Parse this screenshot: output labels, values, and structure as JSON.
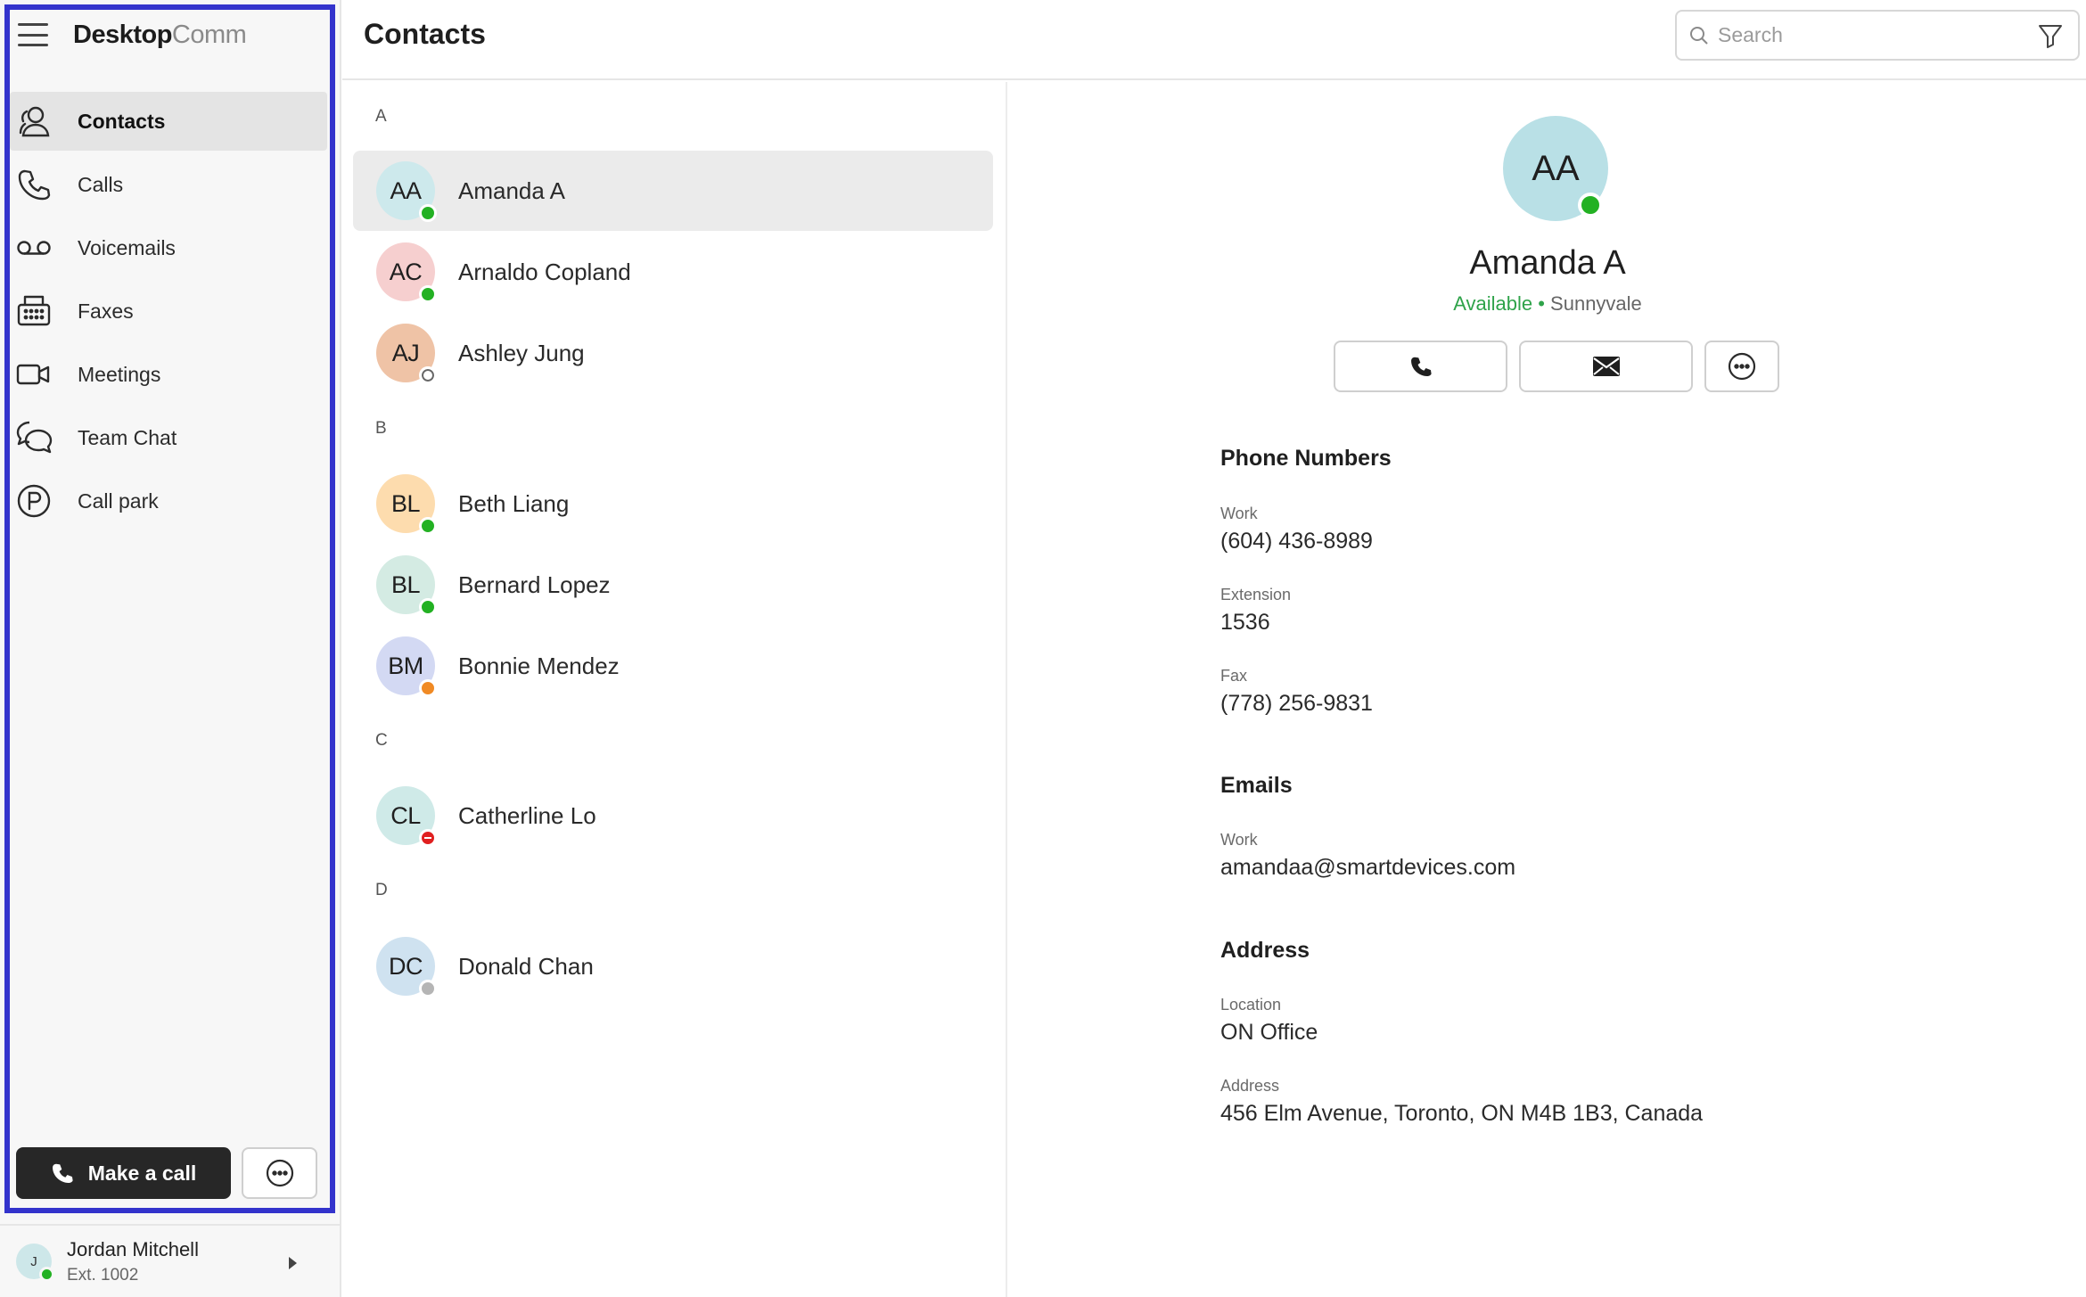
{
  "app": {
    "brand_bold": "Desktop",
    "brand_light": "Comm"
  },
  "nav": [
    {
      "label": "Contacts",
      "icon": "contacts-icon",
      "active": true
    },
    {
      "label": "Calls",
      "icon": "phone-icon",
      "active": false
    },
    {
      "label": "Voicemails",
      "icon": "voicemail-icon",
      "active": false
    },
    {
      "label": "Faxes",
      "icon": "fax-icon",
      "active": false
    },
    {
      "label": "Meetings",
      "icon": "video-icon",
      "active": false
    },
    {
      "label": "Team Chat",
      "icon": "chat-icon",
      "active": false
    },
    {
      "label": "Call park",
      "icon": "park-icon",
      "active": false
    }
  ],
  "make_call_label": "Make a call",
  "user": {
    "initial": "J",
    "name": "Jordan Mitchell",
    "ext": "Ext. 1002",
    "status": "available"
  },
  "header": {
    "title": "Contacts",
    "search_placeholder": "Search"
  },
  "sections": [
    {
      "letter": "A",
      "contacts": [
        {
          "initials": "AA",
          "name": "Amanda A",
          "status": "available",
          "color": "#cde9ec",
          "selected": true
        },
        {
          "initials": "AC",
          "name": "Arnaldo Copland",
          "status": "available",
          "color": "#f6cfcf"
        },
        {
          "initials": "AJ",
          "name": "Ashley Jung",
          "status": "offline",
          "color": "#efc3a6"
        }
      ]
    },
    {
      "letter": "B",
      "contacts": [
        {
          "initials": "BL",
          "name": "Beth Liang",
          "status": "available",
          "color": "#fddcae"
        },
        {
          "initials": "BL",
          "name": "Bernard Lopez",
          "status": "available",
          "color": "#d4ebe3"
        },
        {
          "initials": "BM",
          "name": "Bonnie Mendez",
          "status": "away",
          "color": "#d3d9f3"
        }
      ]
    },
    {
      "letter": "C",
      "contacts": [
        {
          "initials": "CL",
          "name": "Catherline Lo",
          "status": "dnd",
          "color": "#cfeae8"
        }
      ]
    },
    {
      "letter": "D",
      "contacts": [
        {
          "initials": "DC",
          "name": "Donald Chan",
          "status": "unknown",
          "color": "#cfe2f0"
        }
      ]
    }
  ],
  "detail": {
    "initials": "AA",
    "name": "Amanda A",
    "availability": "Available",
    "separator": "•",
    "location": "Sunnyvale",
    "phone_title": "Phone Numbers",
    "phones": [
      {
        "label": "Work",
        "value": "(604) 436-8989"
      },
      {
        "label": "Extension",
        "value": "1536"
      },
      {
        "label": "Fax",
        "value": "(778) 256-9831"
      }
    ],
    "emails_title": "Emails",
    "emails": [
      {
        "label": "Work",
        "value": "amandaa@smartdevices.com"
      }
    ],
    "address_title": "Address",
    "address": [
      {
        "label": "Location",
        "value": "ON Office"
      },
      {
        "label": "Address",
        "value": "456 Elm Avenue, Toronto, ON M4B 1B3, Canada"
      }
    ]
  },
  "colors": {
    "accent_frame": "#3333cc",
    "available": "#23b123",
    "away": "#f08a24",
    "dnd": "#e02020"
  }
}
